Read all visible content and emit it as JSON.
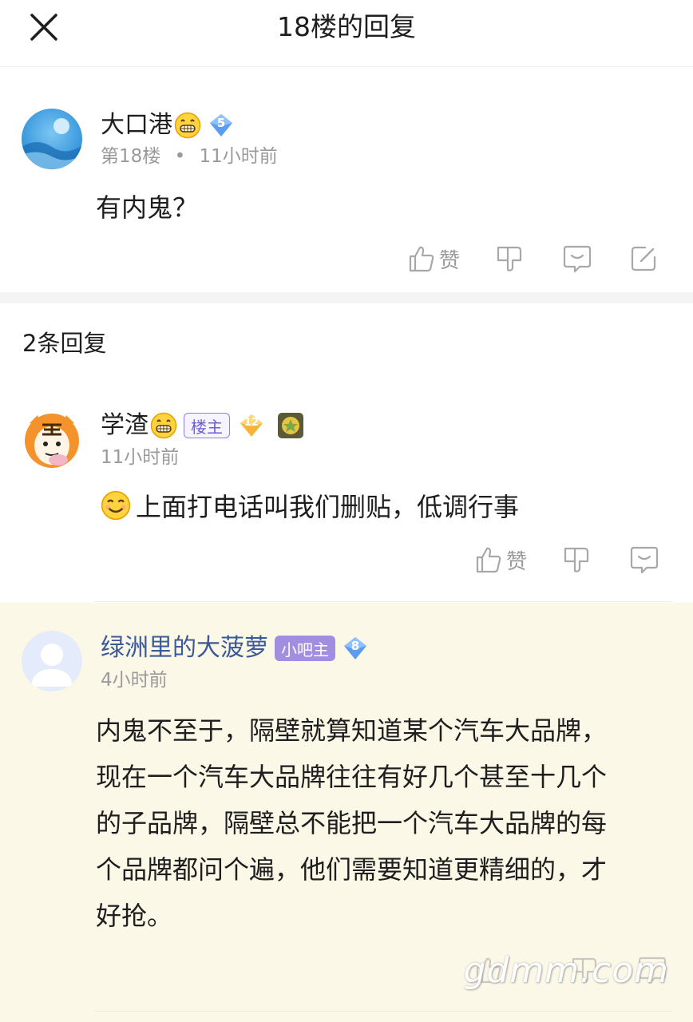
{
  "header": {
    "title": "18楼的回复"
  },
  "main_post": {
    "username": "大口港",
    "level": "5",
    "floor": "第18楼",
    "separator": "•",
    "time": "11小时前",
    "content": "有内鬼？",
    "like_label": "赞"
  },
  "replies_header": "2条回复",
  "replies": [
    {
      "username": "学渣",
      "role_badge": "楼主",
      "level": "12",
      "time": "11小时前",
      "content": "上面打电话叫我们删贴，低调行事",
      "like_label": "赞"
    },
    {
      "username": "绿洲里的大菠萝",
      "role_badge": "小吧主",
      "level": "8",
      "time": "4小时前",
      "content_lines": [
        "内鬼不至于，隔壁就算知道某个汽车大品牌，",
        "现在一个汽车大品牌往往有好几个甚至十几个",
        "的子品牌，隔壁总不能把一个汽车大品牌的每",
        "个品牌都问个遍，他们需要知道更精细的，才",
        "好抢。"
      ]
    }
  ],
  "watermark": "gdmm.com",
  "colors": {
    "highlight_bg": "#fcf8e8",
    "level_badge": "#5b9cf0",
    "lz_badge": "#6b5fd1",
    "xbz_badge": "#a28ee0",
    "gray_text": "#9a9a9a"
  }
}
